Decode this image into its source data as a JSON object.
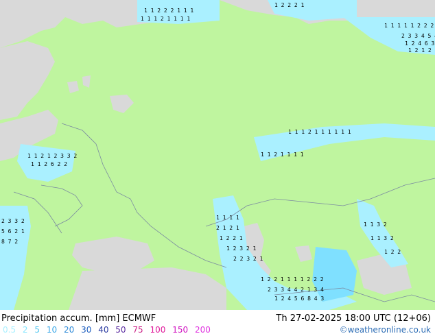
{
  "footer": {
    "title": "Precipitation accum. [mm] ECMWF",
    "time": "Th 27-02-2025 18:00 UTC (12+06)",
    "credit": "©weatheronline.co.uk"
  },
  "legend": {
    "items": [
      {
        "label": "0.5",
        "color": "#aaf0ff"
      },
      {
        "label": "2",
        "color": "#88e6ff"
      },
      {
        "label": "5",
        "color": "#55c8f0"
      },
      {
        "label": "10",
        "color": "#3aa8e8"
      },
      {
        "label": "20",
        "color": "#2e8ad8"
      },
      {
        "label": "30",
        "color": "#1f5fbf"
      },
      {
        "label": "40",
        "color": "#2a3aa0"
      },
      {
        "label": "50",
        "color": "#5a2aa0"
      },
      {
        "label": "75",
        "color": "#cc2288"
      },
      {
        "label": "100",
        "color": "#e0189a"
      },
      {
        "label": "150",
        "color": "#d010c0"
      },
      {
        "label": "200",
        "color": "#e030e0"
      }
    ]
  },
  "colors": {
    "land": "#bff59f",
    "sea": "#d9d9d9",
    "precip_light": "#aaf0ff",
    "precip_medium": "#7fe0ff",
    "border": "#7a8aa0"
  }
}
